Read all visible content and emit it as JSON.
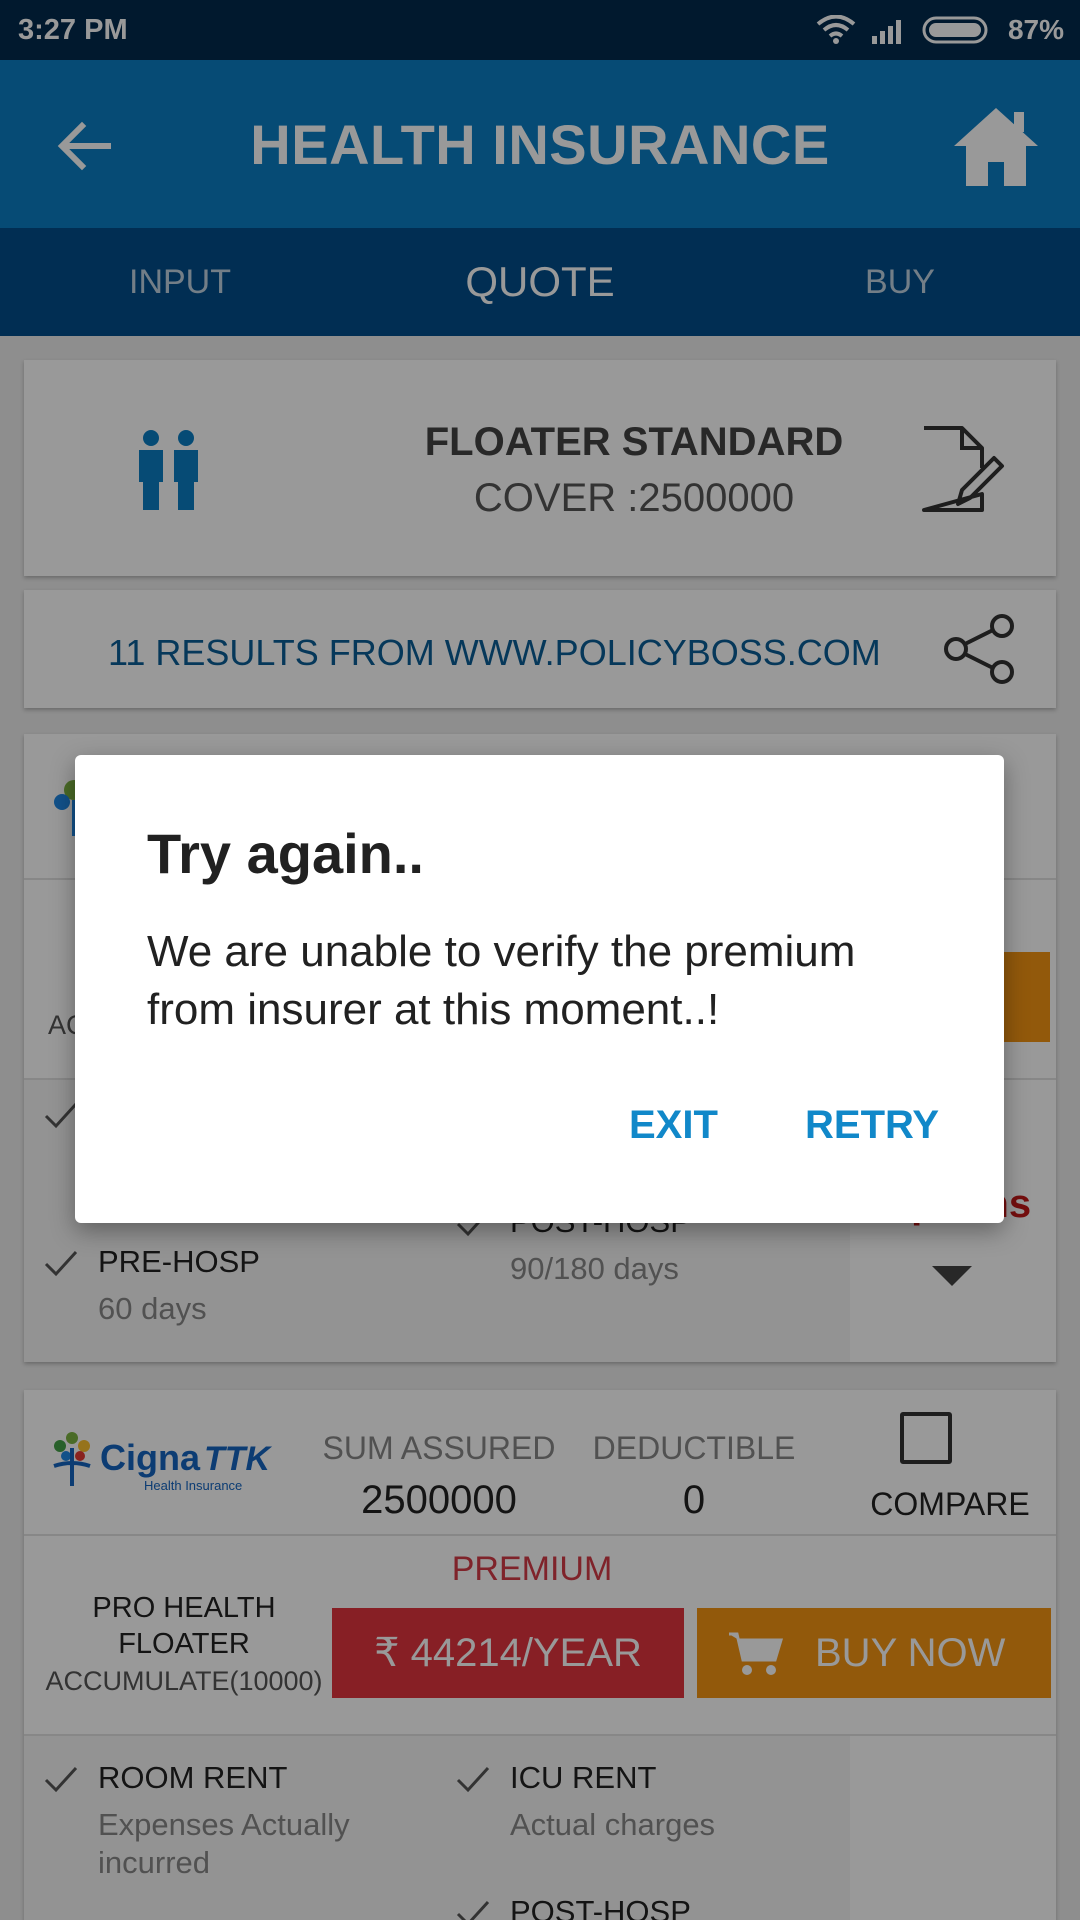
{
  "status_bar": {
    "time": "3:27 PM",
    "battery": "87%"
  },
  "app_bar": {
    "title": "HEALTH INSURANCE"
  },
  "tabs": [
    {
      "label": "INPUT"
    },
    {
      "label": "QUOTE"
    },
    {
      "label": "BUY"
    }
  ],
  "summary": {
    "plan_type": "FLOATER STANDARD",
    "cover": "COVER :2500000"
  },
  "results": {
    "text": "11 RESULTS FROM WWW.POLICYBOSS.COM"
  },
  "plan_card_1": {
    "accumulate_fragment": "AC",
    "options_fragment": "Options",
    "features": [
      {
        "title": "PRE-HOSP",
        "value": "60 days"
      },
      {
        "title": "POST-HOSP",
        "value": "90/180 days"
      }
    ]
  },
  "plan_card_2": {
    "insurer_logo": "Cigna TTK Health Insurance",
    "sum_assured_label": "SUM ASSURED",
    "sum_assured_value": "2500000",
    "deductible_label": "DEDUCTIBLE",
    "deductible_value": "0",
    "compare_label": "COMPARE",
    "premium_label": "PREMIUM",
    "plan_name": "PRO HEALTH FLOATER",
    "accumulate": "ACCUMULATE(10000)",
    "price": "₹ 44214/YEAR",
    "buy_label": "BUY NOW",
    "features": [
      {
        "title": "ROOM RENT",
        "value": "Expenses Actually incurred"
      },
      {
        "title": "ICU RENT",
        "value": "Actual charges"
      },
      {
        "title": "POST-HOSP",
        "value": ""
      }
    ]
  },
  "dialog": {
    "title": "Try again..",
    "message": "We are unable to verify the premium from insurer at this moment..!",
    "exit_label": "EXIT",
    "retry_label": "RETRY"
  },
  "colors": {
    "status_bar": "#022a4e",
    "app_bar": "#0b7ec4",
    "tab_bar": "#034e8a",
    "price_red": "#e1343f",
    "buy_orange": "#f39413",
    "dialog_button": "#1188c9"
  }
}
